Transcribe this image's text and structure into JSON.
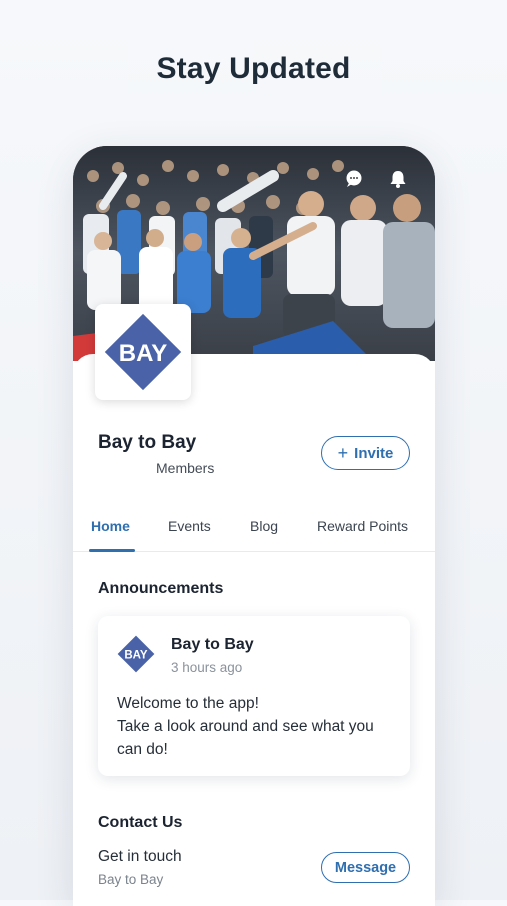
{
  "headline": "Stay Updated",
  "group": {
    "logo_text": "BAY",
    "name": "Bay to Bay",
    "members_label": "Members",
    "invite_label": "Invite",
    "invite_icon": "plus-icon"
  },
  "header_icons": [
    "chat-bubble-icon",
    "bell-icon"
  ],
  "tabs": [
    {
      "label": "Home",
      "active": true
    },
    {
      "label": "Events",
      "active": false
    },
    {
      "label": "Blog",
      "active": false
    },
    {
      "label": "Reward Points",
      "active": false
    }
  ],
  "announcements": {
    "title": "Announcements",
    "post": {
      "author": "Bay to Bay",
      "time": "3 hours ago",
      "line1": "Welcome to the app!",
      "line2": "Take a look around and see what you can do!"
    }
  },
  "contact": {
    "title": "Contact Us",
    "line1": "Get in touch",
    "line2": "Bay to Bay",
    "button_label": "Message"
  },
  "colors": {
    "accent": "#2f6fb0",
    "logo_blue": "#4a63a8"
  }
}
